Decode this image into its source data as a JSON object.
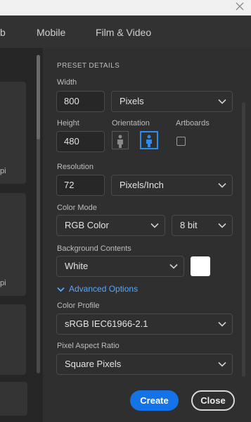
{
  "window": {
    "close_icon": "close-icon"
  },
  "tabs": [
    {
      "label": "b"
    },
    {
      "label": "Mobile"
    },
    {
      "label": "Film & Video"
    }
  ],
  "left_cards": [
    {
      "label": "pi"
    },
    {
      "label": "pi"
    }
  ],
  "preset": {
    "header": "PRESET DETAILS",
    "width_label": "Width",
    "width_value": "800",
    "width_unit": "Pixels",
    "height_label": "Height",
    "height_value": "480",
    "orientation_label": "Orientation",
    "orientation_selected": "landscape",
    "artboards_label": "Artboards",
    "artboards_checked": false,
    "resolution_label": "Resolution",
    "resolution_value": "72",
    "resolution_unit": "Pixels/Inch",
    "color_mode_label": "Color Mode",
    "color_mode_value": "RGB Color",
    "bit_depth_value": "8 bit",
    "background_label": "Background Contents",
    "background_value": "White",
    "background_swatch_color": "#ffffff",
    "advanced_label": "Advanced Options",
    "color_profile_label": "Color Profile",
    "color_profile_value": "sRGB IEC61966-2.1",
    "pixel_aspect_label": "Pixel Aspect Ratio",
    "pixel_aspect_value": "Square Pixels"
  },
  "actions": {
    "create_label": "Create",
    "close_label": "Close"
  },
  "colors": {
    "accent": "#1473e6",
    "link": "#55a6ff",
    "panel": "#2f2f2f"
  }
}
